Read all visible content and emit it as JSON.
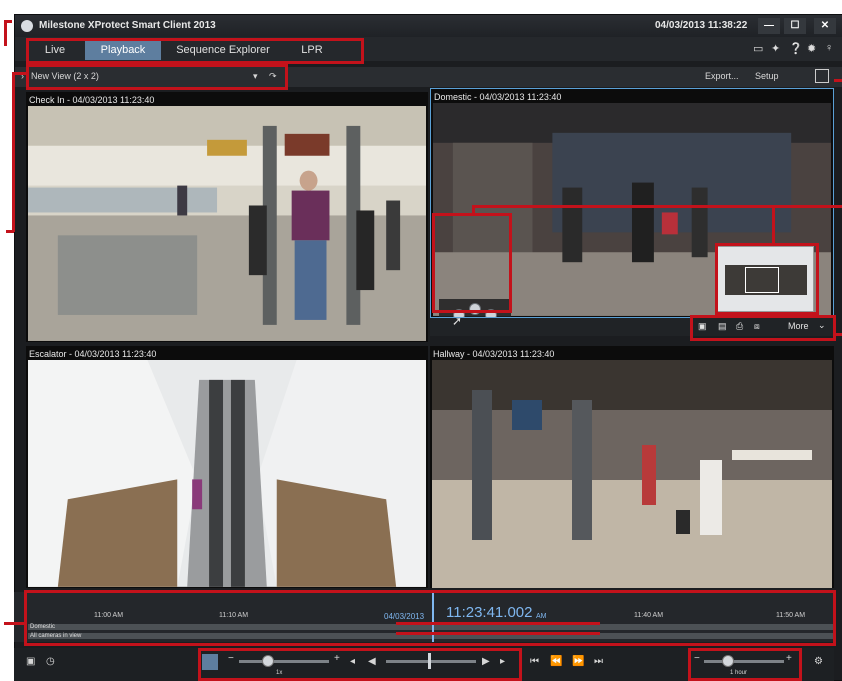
{
  "titlebar": {
    "app_title": "Milestone XProtect Smart Client 2013",
    "datetime": "04/03/2013 11:38:22",
    "minimize": "—",
    "maximize": "☐",
    "close": "✕"
  },
  "tabs": [
    {
      "label": "Live",
      "active": false
    },
    {
      "label": "Playback",
      "active": true
    },
    {
      "label": "Sequence Explorer",
      "active": false
    },
    {
      "label": "LPR",
      "active": false
    }
  ],
  "top_icons": [
    "monitor-icon",
    "network-icon",
    "help-icon",
    "settings-icon",
    "user-icon"
  ],
  "viewbar": {
    "view_name": "New View (2 x 2)",
    "export_label": "Export...",
    "setup_label": "Setup"
  },
  "cameras": [
    {
      "title": "Check In - 04/03/2013 11:23:40"
    },
    {
      "title": "Domestic - 04/03/2013 11:23:40"
    },
    {
      "title": "Escalator - 04/03/2013 11:23:40"
    },
    {
      "title": "Hallway - 04/03/2013 11:23:40"
    }
  ],
  "camera_toolbar": {
    "more_label": "More"
  },
  "timeline": {
    "ticks": [
      "11:00 AM",
      "11:10 AM",
      "04/03/2013",
      "11:40 AM",
      "11:50 AM"
    ],
    "current_time": "11:23:41.002",
    "current_suffix": "AM",
    "track_labels": [
      "Domestic",
      "All cameras in view"
    ]
  },
  "playback": {
    "speed_label": "1x",
    "interval_label": "1 hour"
  },
  "colors": {
    "accent": "#5e7e9f",
    "callout_red": "#c3121b",
    "time_blue": "#7fb7f0"
  }
}
